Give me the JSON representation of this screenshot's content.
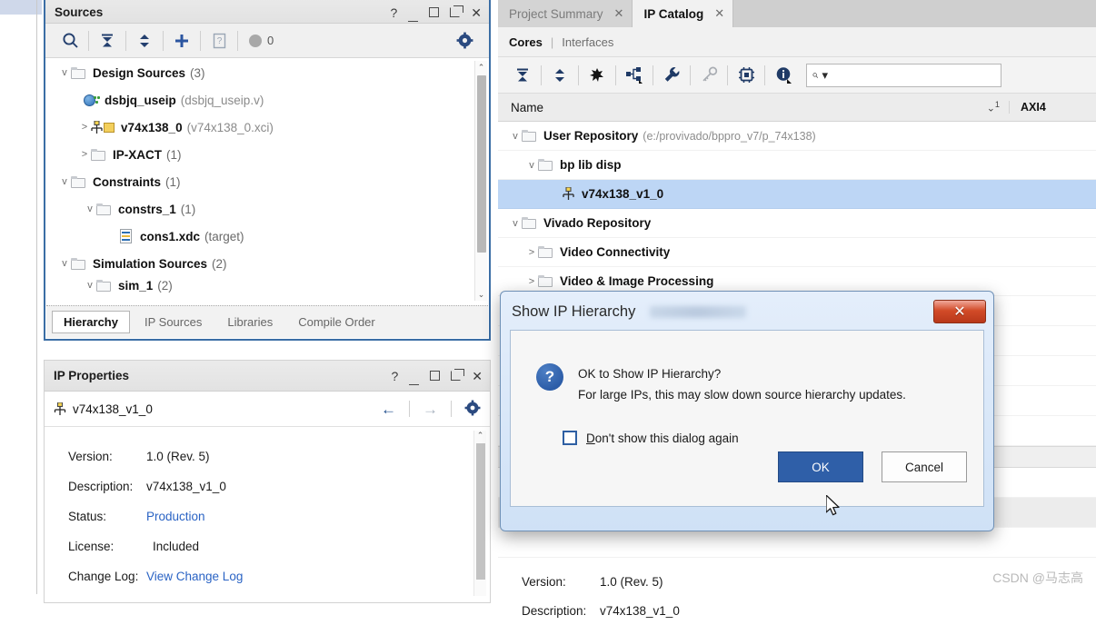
{
  "sources_panel": {
    "title": "Sources",
    "window_buttons": [
      "?",
      "_",
      "□",
      "⊐",
      "✕"
    ],
    "toolbar": {
      "search_icon": "search-icon",
      "collapse_icon": "collapse-all-icon",
      "expand_icon": "expand-all-icon",
      "add_icon": "add-sources-icon",
      "report_icon": "report-icon",
      "badge_count": "0",
      "settings_icon": "gear-icon"
    },
    "tree": [
      {
        "indent": 0,
        "twisty": "v",
        "icon": "folder",
        "name": "Design Sources",
        "suffix": "(3)"
      },
      {
        "indent": 1,
        "twisty": "",
        "icon": "verilog",
        "name": "dsbjq_useip",
        "suffix": "(dsbjq_useip.v)"
      },
      {
        "indent": 1,
        "twisty": ">",
        "icon": "ip",
        "name": "v74x138_0",
        "suffix": "(v74x138_0.xci)"
      },
      {
        "indent": 1,
        "twisty": ">",
        "icon": "folder",
        "name": "IP-XACT",
        "suffix": "(1)"
      },
      {
        "indent": 0,
        "twisty": "v",
        "icon": "folder",
        "name": "Constraints",
        "suffix": "(1)"
      },
      {
        "indent": 1,
        "twisty": "v",
        "icon": "folder",
        "name": "constrs_1",
        "suffix": "(1)"
      },
      {
        "indent": 2,
        "twisty": "",
        "icon": "xdc",
        "name": "cons1.xdc",
        "suffix": "(target)"
      },
      {
        "indent": 0,
        "twisty": "v",
        "icon": "folder",
        "name": "Simulation Sources",
        "suffix": "(2)"
      },
      {
        "indent": 1,
        "twisty": "v",
        "icon": "folder",
        "name": "sim_1",
        "suffix": "(2)"
      }
    ],
    "tabs": [
      {
        "label": "Hierarchy",
        "active": true
      },
      {
        "label": "IP Sources",
        "active": false
      },
      {
        "label": "Libraries",
        "active": false
      },
      {
        "label": "Compile Order",
        "active": false
      }
    ]
  },
  "ip_properties": {
    "title": "IP Properties",
    "window_buttons": [
      "?",
      "_",
      "□",
      "⊐",
      "✕"
    ],
    "selected_ip": "v74x138_v1_0",
    "nav": {
      "back": "←",
      "forward": "→",
      "settings": "gear-icon"
    },
    "rows": [
      {
        "label": "Version:",
        "value": "1.0 (Rev. 5)",
        "link": false
      },
      {
        "label": "Description:",
        "value": "v74x138_v1_0",
        "link": false
      },
      {
        "label": "Status:",
        "value": "Production",
        "link": true
      },
      {
        "label": "License:",
        "value": "Included",
        "link": false
      },
      {
        "label": "Change Log:",
        "value": "View Change Log",
        "link": true
      }
    ]
  },
  "catalog": {
    "tabs": [
      {
        "label": "Project Summary",
        "active": false,
        "close": "✕"
      },
      {
        "label": "IP Catalog",
        "active": true,
        "close": "✕"
      }
    ],
    "subtabs": {
      "cores": "Cores",
      "separator": "|",
      "interfaces": "Interfaces"
    },
    "toolbar": {
      "collapse_icon": "collapse-all-icon",
      "expand_icon": "expand-all-icon",
      "group_icon": "group-by-icon",
      "hierarchy_icon": "hierarchy-icon",
      "wrench_icon": "customize-icon",
      "key_icon": "license-key-icon",
      "chip_icon": "chip-icon",
      "info_icon": "info-icon",
      "search_placeholder": ""
    },
    "columns": {
      "name": "Name",
      "sort_marker": "1",
      "axi4": "AXI4"
    },
    "tree": [
      {
        "indent": 0,
        "twisty": "v",
        "icon": "folder",
        "name": "User Repository",
        "path": "(e:/provivado/bppro_v7/p_74x138)",
        "selected": false
      },
      {
        "indent": 1,
        "twisty": "v",
        "icon": "folder",
        "name": "bp lib disp",
        "path": "",
        "selected": false
      },
      {
        "indent": 2,
        "twisty": "",
        "icon": "ip",
        "name": "v74x138_v1_0",
        "path": "",
        "selected": true
      },
      {
        "indent": 0,
        "twisty": "v",
        "icon": "folder",
        "name": "Vivado Repository",
        "path": "",
        "selected": false
      },
      {
        "indent": 1,
        "twisty": ">",
        "icon": "folder",
        "name": "Video Connectivity",
        "path": "",
        "selected": false
      },
      {
        "indent": 1,
        "twisty": ">",
        "icon": "folder",
        "name": "Video & Image Processing",
        "path": "",
        "selected": false
      }
    ],
    "bottom_properties": [
      {
        "label": "Version:",
        "value": "1.0 (Rev. 5)"
      },
      {
        "label": "Description:",
        "value": "v74x138_v1_0"
      }
    ]
  },
  "dialog": {
    "title": "Show IP Hierarchy",
    "close_label": "✕",
    "icon": "question-icon",
    "message_line1": "OK to Show IP Hierarchy?",
    "message_line2": "For large IPs, this may slow down source hierarchy updates.",
    "checkbox_label_prefix": "D",
    "checkbox_label_rest": "on't show this dialog again",
    "checkbox_checked": false,
    "ok_label": "OK",
    "cancel_label": "Cancel"
  },
  "watermark": "CSDN @马志高",
  "colors": {
    "panel_border_focus": "#3b6ea5",
    "selection_blue": "#bdd6f5",
    "link_blue": "#2a63c4",
    "ok_button": "#2f5fa8",
    "close_red": "#d24b28",
    "icon_navy": "#233f6e"
  }
}
